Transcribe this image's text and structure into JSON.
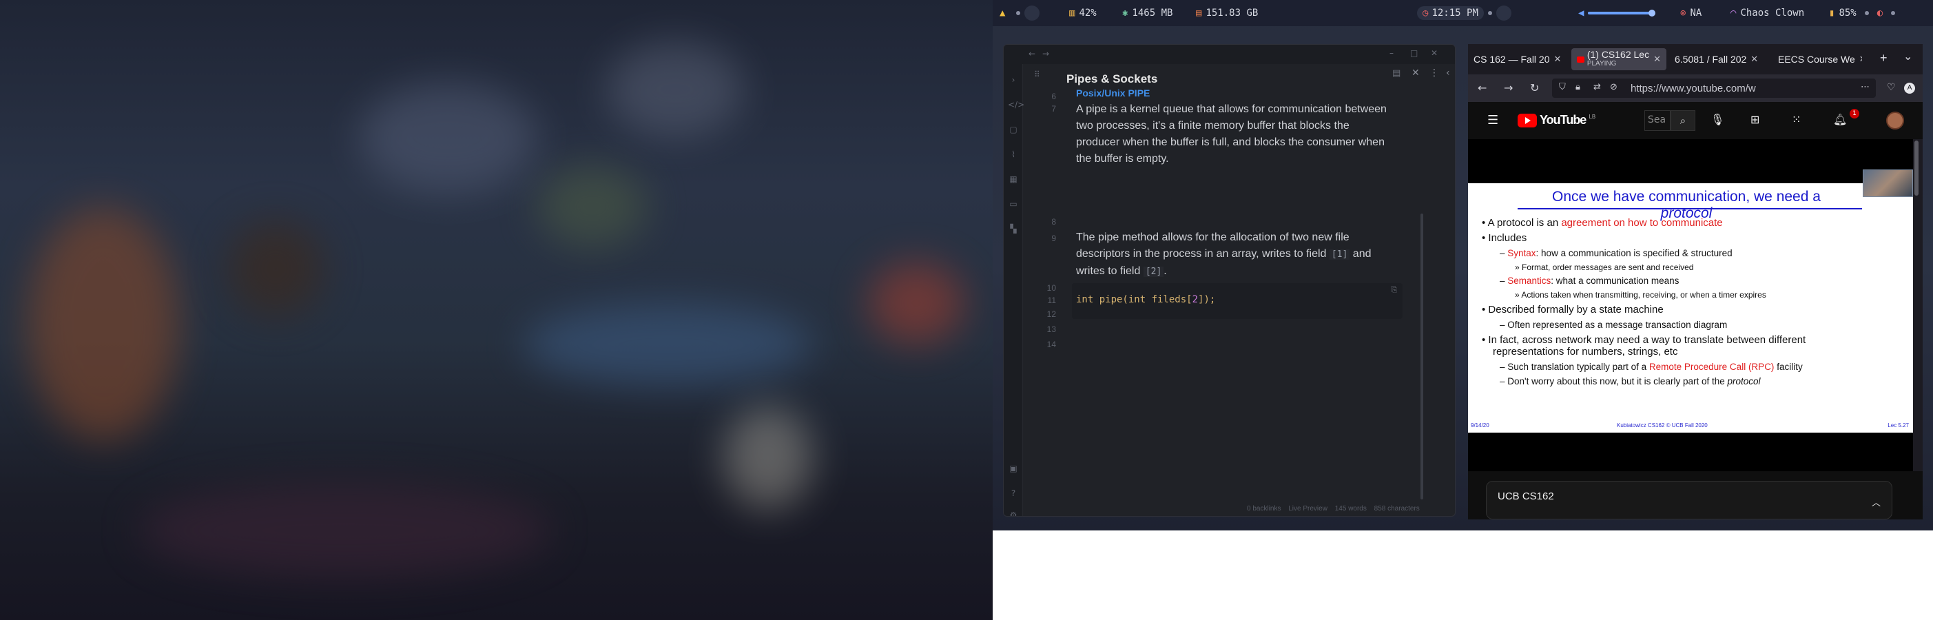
{
  "topbar": {
    "cpu": "42%",
    "ram": "1465 MB",
    "disk": "151.83 GB",
    "clock": "12:15 PM",
    "network": "NA",
    "wifi": "Chaos Clown",
    "battery": "85%"
  },
  "obsidian": {
    "note_title": "Pipes & Sockets",
    "heading_partial": "Posix/Unix PIPE",
    "line_numbers": [
      "6",
      "7",
      "8",
      "9",
      "10",
      "11",
      "12",
      "13",
      "14"
    ],
    "paragraph1": [
      "A pipe is a kernel queue that allows for communication between",
      "two processes, it's a finite memory buffer that blocks the",
      "producer when the buffer is full, and blocks the consumer when",
      "the buffer is empty."
    ],
    "paragraph2_l1": "The pipe method allows for the allocation of two new file",
    "paragraph2_l2_a": "descriptors in the process in an array, writes to field ",
    "paragraph2_l2_code": "[1]",
    "paragraph2_l2_b": " and",
    "paragraph2_l3_a": "writes to field ",
    "paragraph2_l3_code": "[2]",
    "paragraph2_l3_b": ".",
    "code_a": "int pipe(int fileds[",
    "code_num": "2",
    "code_b": "]);",
    "status": {
      "backlinks": "0 backlinks",
      "mode": "Live Preview",
      "words": "145 words",
      "chars": "858 characters"
    }
  },
  "firefox": {
    "tabs": [
      {
        "label": "CS 162 — Fall 20",
        "active": false
      },
      {
        "label": "(1) CS162 Lec",
        "sub": "PLAYING",
        "active": true
      },
      {
        "label": "6.5081 / Fall 202",
        "active": false
      },
      {
        "label": "EECS Course We",
        "active": false
      }
    ],
    "url": "https://www.youtube.com/w",
    "new_tab": "+",
    "tab_list": "⌄"
  },
  "youtube": {
    "logo_text": "YouTube",
    "logo_country": "LB",
    "search_placeholder": "Sea",
    "notification_count": "1",
    "slide": {
      "title_a": "Once we have communication, we need a ",
      "title_b": "protocol",
      "bullets": [
        {
          "level": 1,
          "a": "A protocol is an ",
          "red": "agreement on how to communicate",
          "b": ""
        },
        {
          "level": 1,
          "a": "Includes",
          "red": "",
          "b": ""
        },
        {
          "level": 2,
          "a": "– ",
          "red": "Syntax",
          "b": ": how a communication is specified & structured"
        },
        {
          "level": 3,
          "a": "» Format, order messages are sent and received",
          "red": "",
          "b": ""
        },
        {
          "level": 2,
          "a": "– ",
          "red": "Semantics",
          "b": ": what a communication means"
        },
        {
          "level": 3,
          "a": "» Actions taken when transmitting, receiving, or when a timer expires",
          "red": "",
          "b": ""
        },
        {
          "level": 1,
          "a": "Described formally by a state machine",
          "red": "",
          "b": ""
        },
        {
          "level": 2,
          "a": "– Often represented as a message transaction diagram",
          "red": "",
          "b": ""
        },
        {
          "level": 1,
          "a": "In fact, across network may need a way to translate between different",
          "red": "",
          "b": ""
        },
        {
          "level": 1,
          "a": "representations for numbers, strings, etc",
          "red": "",
          "b": ""
        },
        {
          "level": 2,
          "a": "– Such translation typically part of a ",
          "red": "Remote Procedure Call (RPC)",
          "b": " facility"
        },
        {
          "level": 2,
          "a": "– Don't worry about this now, but it is clearly part of the ",
          "red": "",
          "b": "",
          "it": "protocol"
        }
      ],
      "footer_left": "9/14/20",
      "footer_center": "Kubiatowicz CS162 © UCB Fall 2020",
      "footer_right": "Lec 5.27"
    },
    "live_chat_title": "UCB CS162"
  }
}
